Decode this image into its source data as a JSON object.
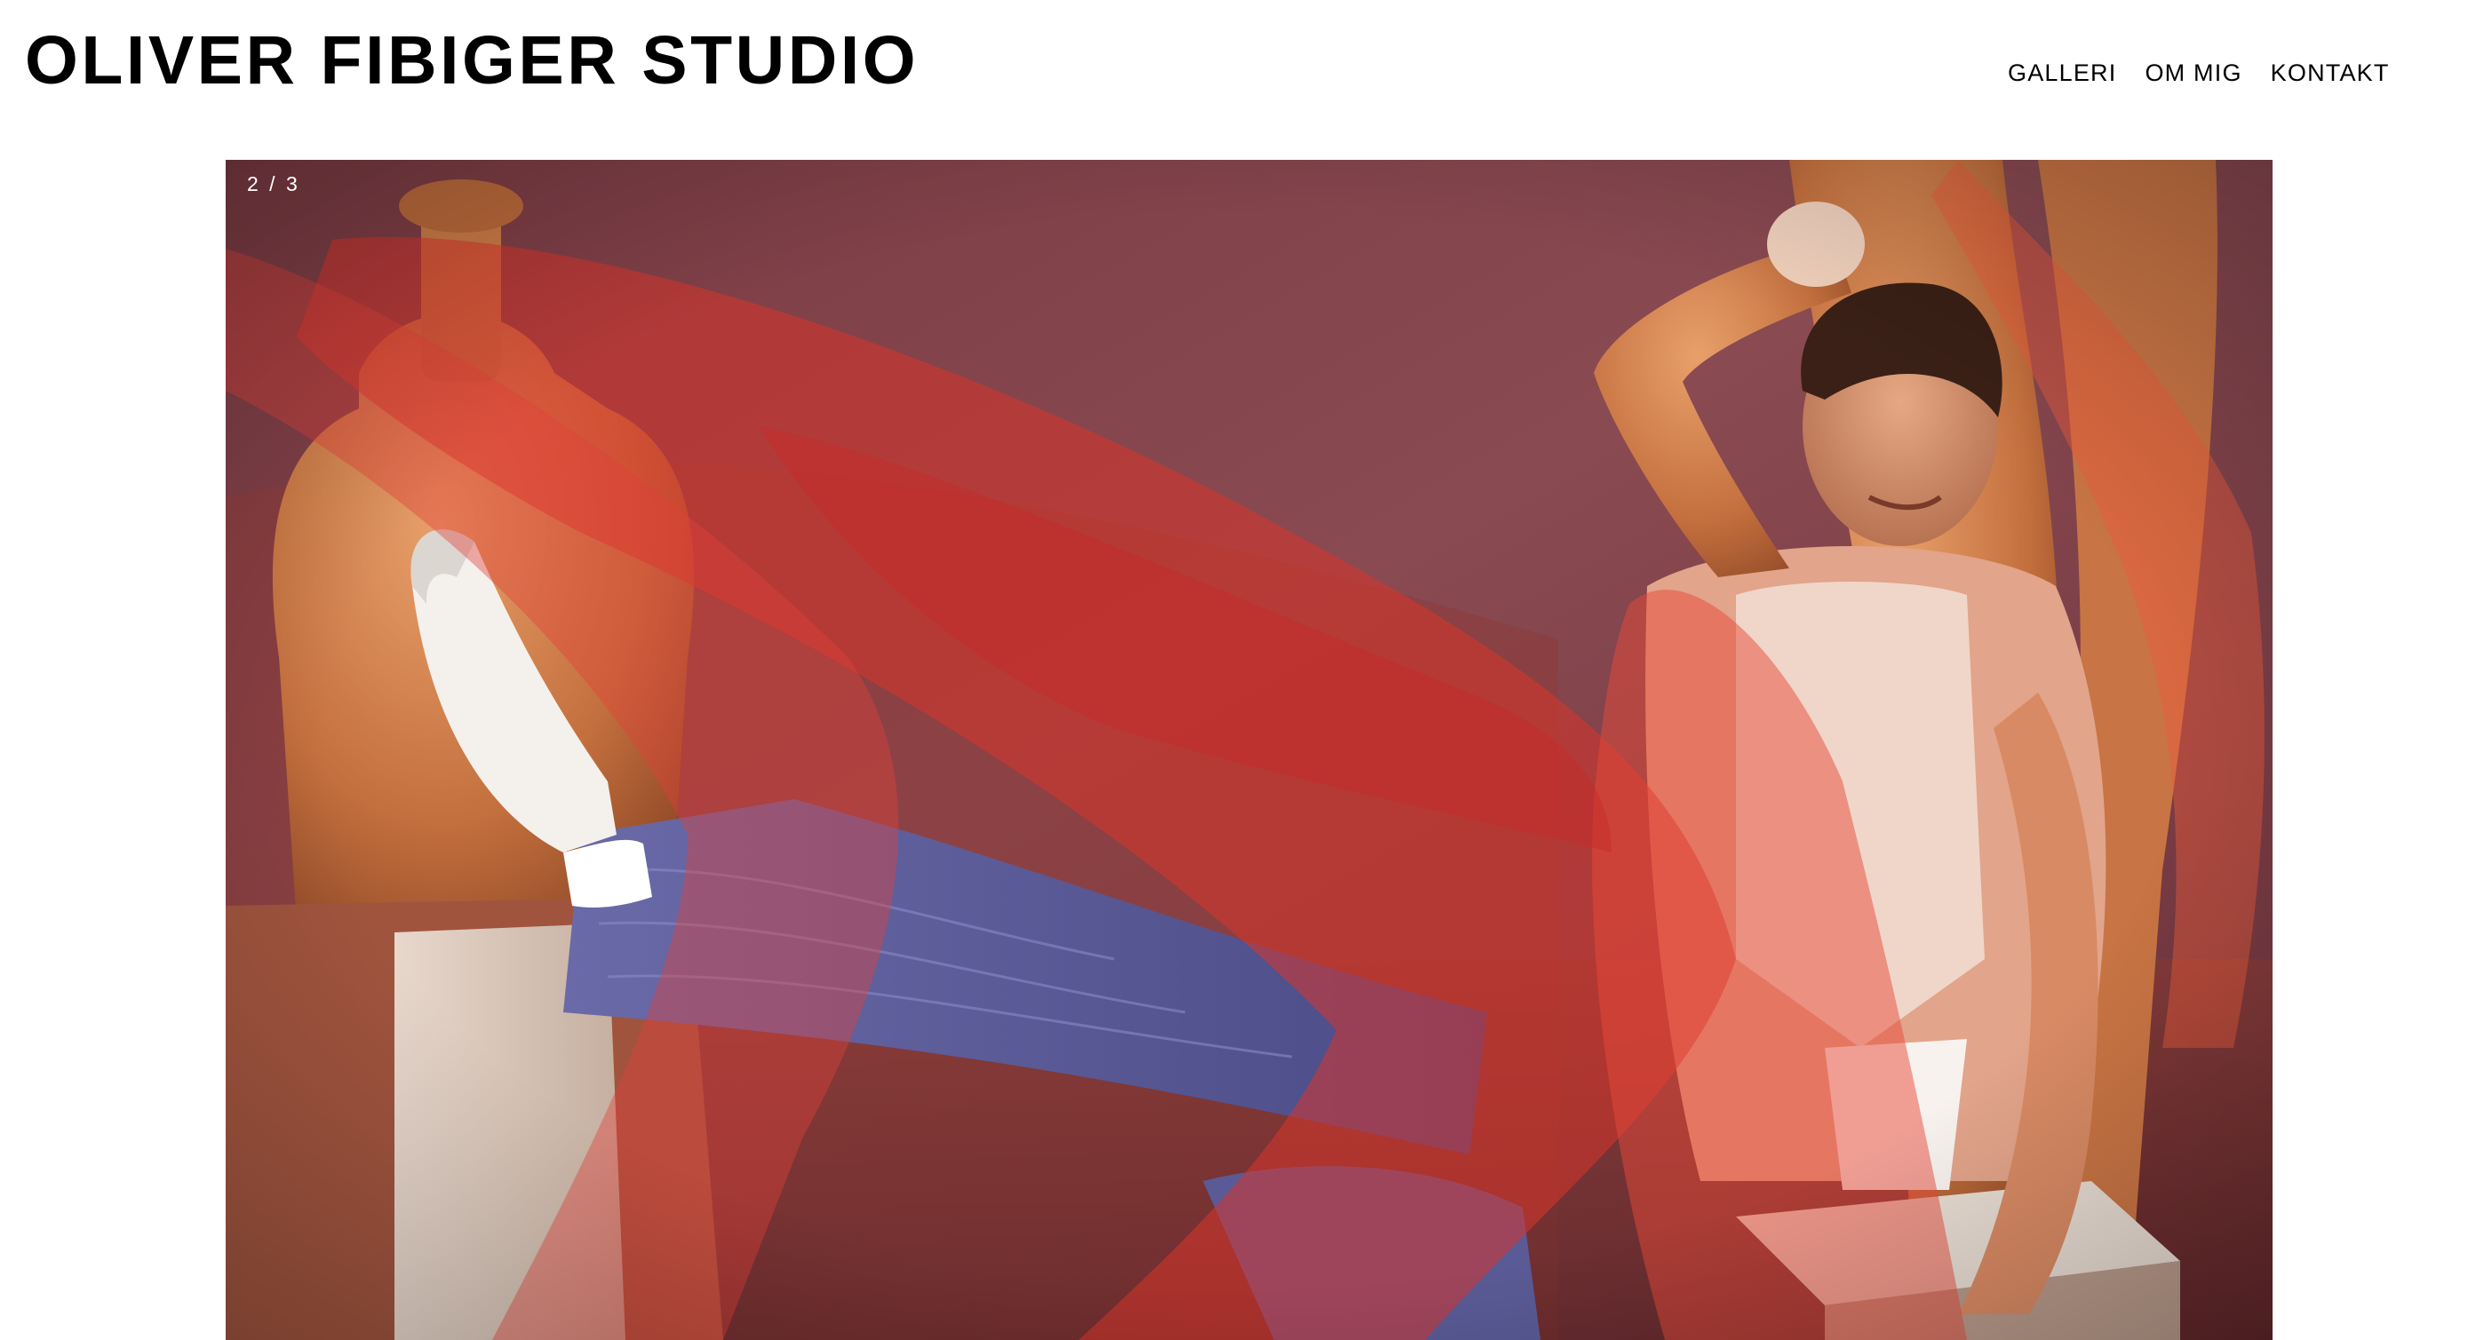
{
  "site": {
    "title": "OLIVER FIBIGER STUDIO"
  },
  "nav": {
    "items": [
      {
        "label": "GALLERI"
      },
      {
        "label": "OM MIG"
      },
      {
        "label": "KONTAKT"
      }
    ]
  },
  "gallery": {
    "counter": "2 / 3",
    "current": 2,
    "total": 3
  },
  "colors": {
    "background": "#ffffff",
    "text": "#000000",
    "counter_text": "#ffffff"
  }
}
